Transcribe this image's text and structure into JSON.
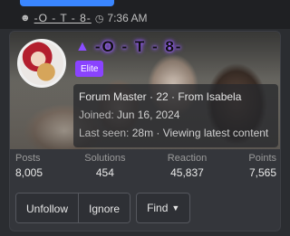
{
  "header": {
    "username": "-O - T - 8-",
    "time": "7:36 AM"
  },
  "profile": {
    "username": "-O - T - 8-",
    "badge": "Elite",
    "title_line": "Forum Master · 22 · From Isabela",
    "joined_label": "Joined:",
    "joined_value": "Jun 16, 2024",
    "lastseen_label": "Last seen:",
    "lastseen_value": "28m · Viewing latest content"
  },
  "stats": [
    {
      "label": "Posts",
      "value": "8,005"
    },
    {
      "label": "Solutions",
      "value": "454"
    },
    {
      "label": "Reaction",
      "value": "45,837"
    },
    {
      "label": "Points",
      "value": "7,565"
    }
  ],
  "actions": {
    "unfollow": "Unfollow",
    "ignore": "Ignore",
    "find": "Find"
  },
  "icons": {
    "user": "user-icon",
    "clock": "clock-icon",
    "caret": "caret-down-icon"
  },
  "colors": {
    "accent": "#3a86ff",
    "badge": "#8a43ff"
  }
}
